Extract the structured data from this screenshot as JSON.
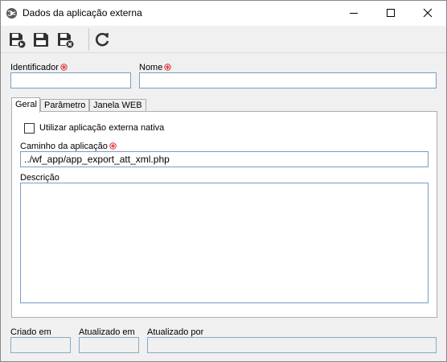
{
  "window": {
    "title": "Dados da aplicação externa",
    "icons": {
      "app": "globe-gear-icon",
      "minimize": "minimize-icon",
      "maximize": "maximize-icon",
      "close": "close-icon"
    }
  },
  "toolbar": {
    "buttons": [
      {
        "name": "save-new-icon"
      },
      {
        "name": "save-icon"
      },
      {
        "name": "save-close-icon"
      },
      {
        "name": "refresh-icon"
      }
    ]
  },
  "form": {
    "identificador_label": "Identificador",
    "identificador_value": "",
    "nome_label": "Nome",
    "nome_value": "",
    "required_icon": "required-asterisk-icon",
    "required_color": "#e0242a"
  },
  "tabs": [
    {
      "label": "Geral",
      "active": true
    },
    {
      "label": "Parâmetro",
      "active": false
    },
    {
      "label": "Janela WEB",
      "active": false
    }
  ],
  "geral": {
    "checkbox_label": "Utilizar aplicação externa nativa",
    "checkbox_checked": false,
    "caminho_label": "Caminho da aplicação",
    "caminho_value": "../wf_app/app_export_att_xml.php",
    "descricao_label": "Descrição",
    "descricao_value": ""
  },
  "footer": {
    "criado_em_label": "Criado em",
    "criado_em_value": "",
    "atualizado_em_label": "Atualizado em",
    "atualizado_em_value": "",
    "atualizado_por_label": "Atualizado por",
    "atualizado_por_value": ""
  }
}
